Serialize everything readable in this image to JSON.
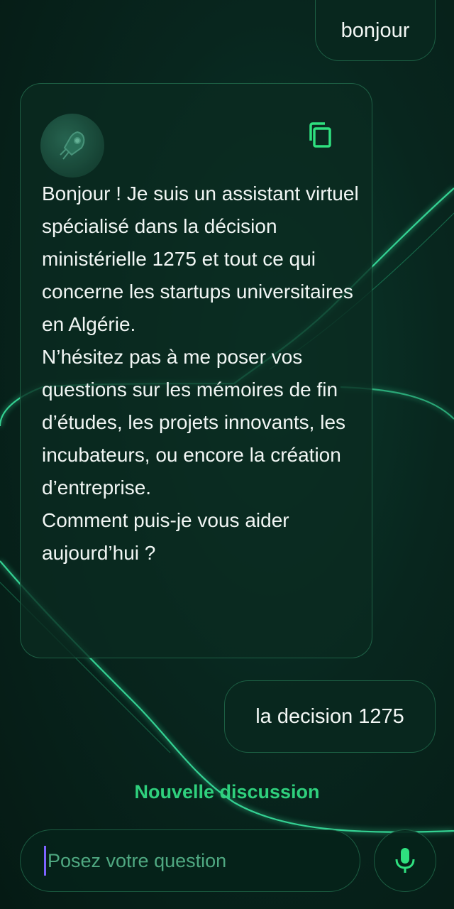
{
  "messages": {
    "user_1": "bonjour",
    "assistant_1": "Bonjour ! Je suis un assistant virtuel spécialisé dans la décision ministérielle 1275 et tout ce qui concerne les startups universitaires en Algérie.\nN’hésitez pas à me poser vos questions sur les mémoires de fin d’études, les projets innovants, les incubateurs, ou encore la création d’entreprise.\nComment puis-je vous aider aujourd’hui ?",
    "user_2": "la decision 1275"
  },
  "actions": {
    "new_discussion": "Nouvelle discussion"
  },
  "input": {
    "placeholder": "Posez votre question"
  },
  "icons": {
    "avatar": "rocket-icon",
    "copy": "copy-icon",
    "mic": "microphone-icon"
  },
  "colors": {
    "accent": "#2fd07d",
    "background": "#08261e"
  }
}
